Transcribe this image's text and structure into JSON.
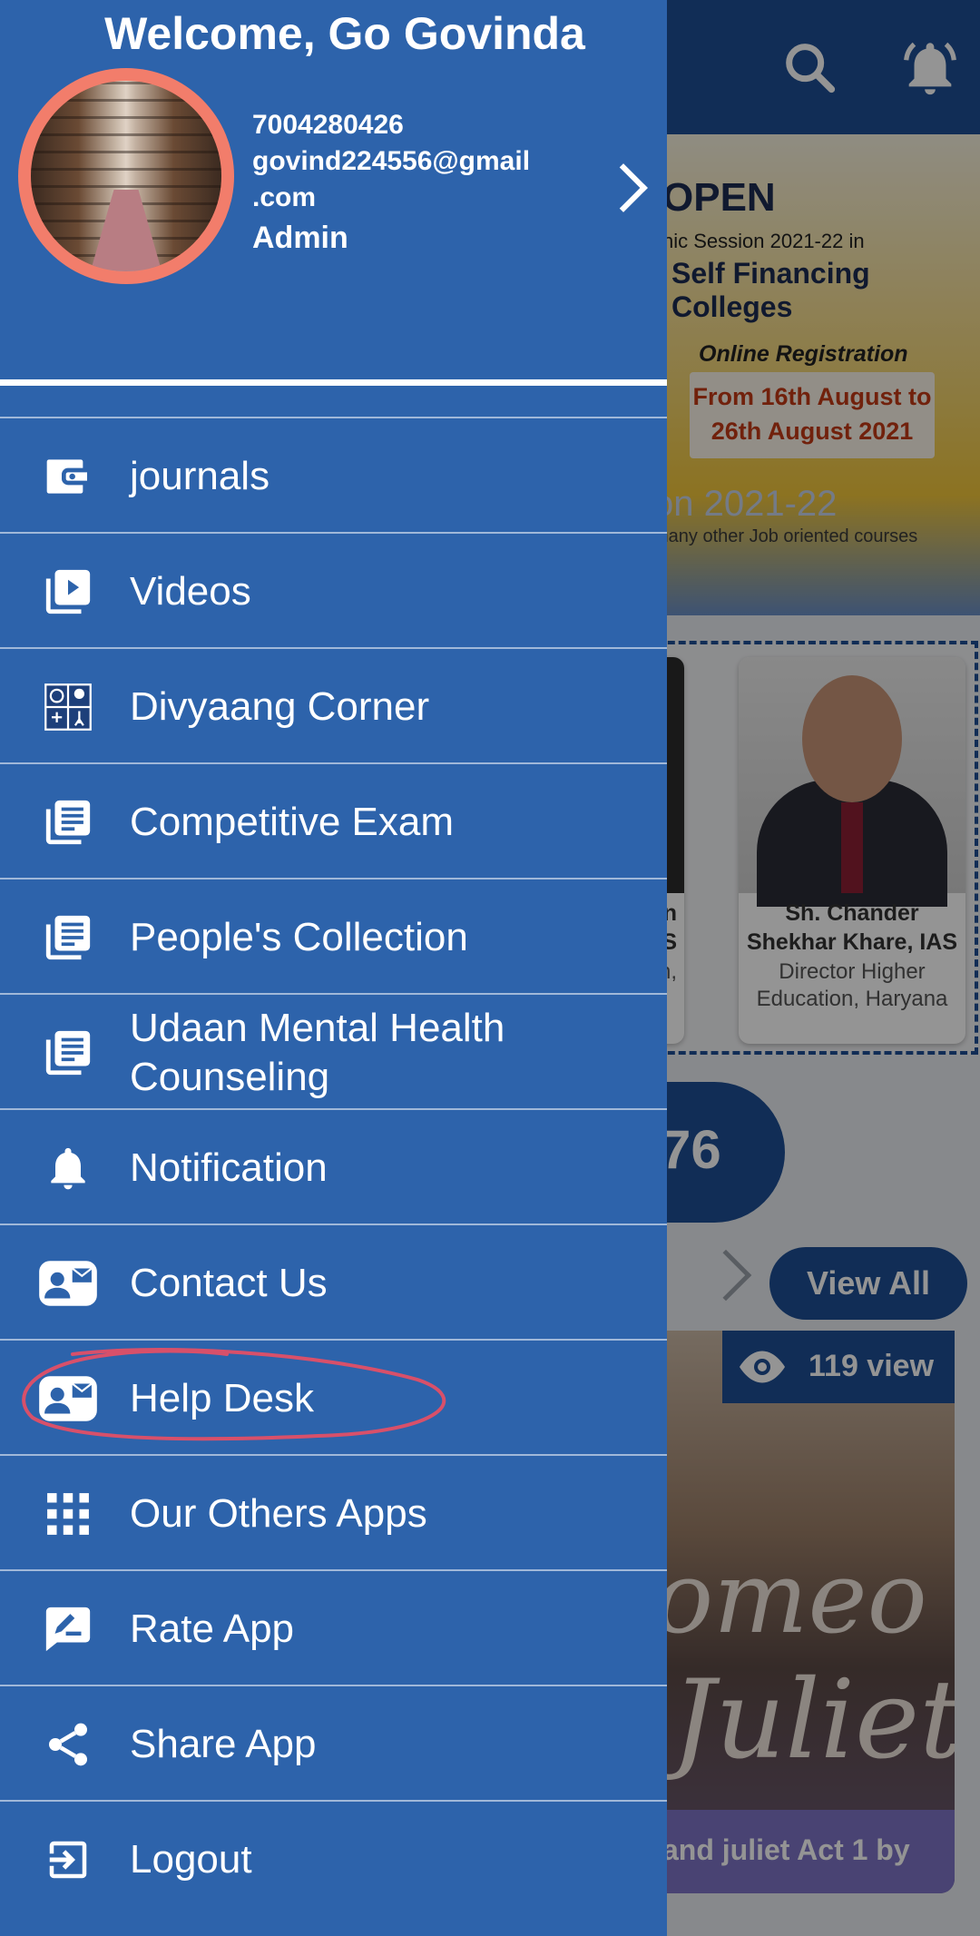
{
  "background": {
    "banner": {
      "line1": "OPEN",
      "line2": "nic Session 2021-22 in",
      "line3": "Self Financing Colleges",
      "line4": "Online Registration",
      "line5": "From 16th August to 26th August 2021",
      "line6": "on 2021-22",
      "line7": "many other Job oriented courses"
    },
    "people": [
      {
        "name_l1": "han",
        "name_l2": "S",
        "role": "tary ion,"
      },
      {
        "name_l1": "Sh. Chander",
        "name_l2": "Shekhar Khare, IAS",
        "role": "Director Higher Education, Haryana"
      }
    ],
    "count_partial": "76",
    "view_all": "View All",
    "book": {
      "views": "119 view",
      "title_l1": "omeo",
      "title_l2": "Juliet",
      "caption": "and juliet Act 1 by"
    }
  },
  "drawer": {
    "welcome": "Welcome, Go Govinda",
    "phone": "7004280426",
    "email_l1": "govind224556@gmail",
    "email_l2": ".com",
    "role": "Admin",
    "items": [
      {
        "label": "journals",
        "icon": "wallet-icon"
      },
      {
        "label": "Videos",
        "icon": "video-library-icon"
      },
      {
        "label": "Divyaang Corner",
        "icon": "accessibility-icon"
      },
      {
        "label": "Competitive Exam",
        "icon": "library-books-icon"
      },
      {
        "label": "People's Collection",
        "icon": "library-books-icon"
      },
      {
        "label": "Udaan Mental Health Counseling",
        "icon": "library-books-icon"
      },
      {
        "label": "Notification",
        "icon": "bell-icon"
      },
      {
        "label": "Contact Us",
        "icon": "contact-mail-icon"
      },
      {
        "label": "Help Desk",
        "icon": "contact-mail-icon"
      },
      {
        "label": "Our Others Apps",
        "icon": "apps-grid-icon"
      },
      {
        "label": "Rate App",
        "icon": "rate-review-icon"
      },
      {
        "label": "Share App",
        "icon": "share-icon"
      },
      {
        "label": "Logout",
        "icon": "logout-icon"
      }
    ]
  },
  "colors": {
    "drawer_bg": "#2d63ab",
    "appbar_bg": "#1e4f94",
    "avatar_ring": "#f27d6b",
    "annotation": "#d8506a"
  }
}
